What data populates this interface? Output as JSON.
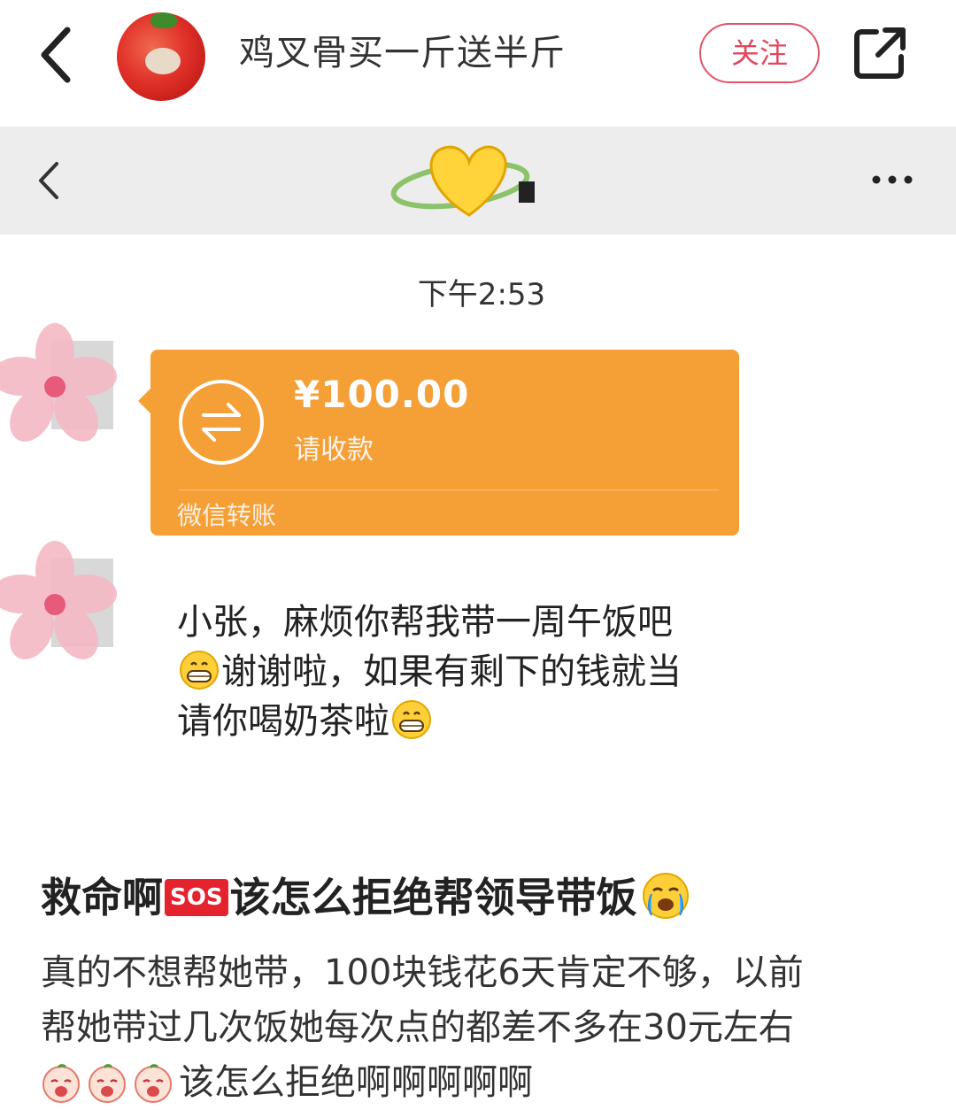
{
  "topbar": {
    "author_name": "鸡叉骨买一斤送半斤",
    "follow_label": "关注",
    "icons": [
      "back-chevron-icon",
      "share-icon"
    ]
  },
  "chat": {
    "time": "下午2:53",
    "transfer": {
      "amount": "¥100.00",
      "status": "请收款",
      "source": "微信转账"
    },
    "message": {
      "line1": "小张，麻烦你帮我带一周午饭吧",
      "line2": "谢谢啦，如果有剩下的钱就当",
      "line3": "请你喝奶茶啦"
    }
  },
  "post": {
    "title_part1": "救命啊",
    "sos": "SOS",
    "title_part2": "该怎么拒绝帮领导带饭",
    "body_line1": "真的不想帮她带，100块钱花6天肯定不够，以前",
    "body_line2": "帮她带过几次饭她每次点的都差不多在30元左右",
    "body_line3": "该怎么拒绝啊啊啊啊啊"
  },
  "colors": {
    "accent_red": "#e0485f",
    "transfer_orange": "#f59f37",
    "chat_header_bg": "#ededed"
  }
}
